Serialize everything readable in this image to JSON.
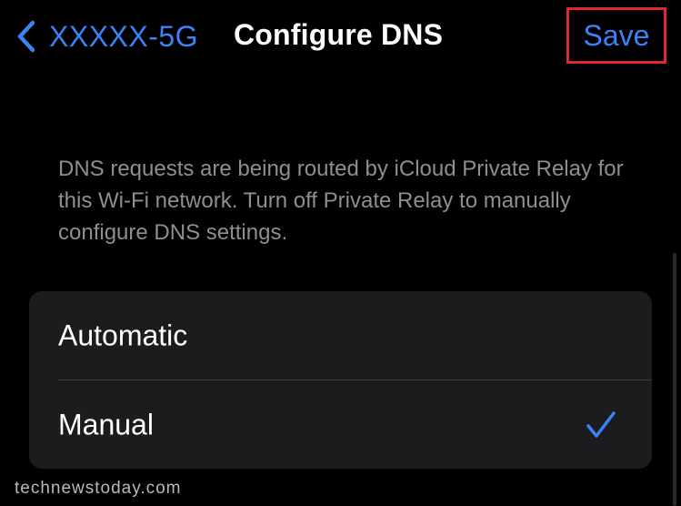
{
  "navbar": {
    "back_label": "XXXXX-5G",
    "title": "Configure DNS",
    "save_label": "Save"
  },
  "info": {
    "text": "DNS requests are being routed by iCloud Private Relay for this Wi-Fi network. Turn off Private Relay to manually configure DNS settings."
  },
  "options": [
    {
      "label": "Automatic",
      "selected": false
    },
    {
      "label": "Manual",
      "selected": true
    }
  ],
  "watermark": "technewstoday.com",
  "icons": {
    "back": "chevron-left-icon",
    "selected": "checkmark-icon"
  },
  "colors": {
    "accent": "#3b82f6",
    "highlight_border": "#e0262f",
    "background": "#000000",
    "group_background": "#1c1c1e",
    "secondary_text": "#8e8e93"
  }
}
